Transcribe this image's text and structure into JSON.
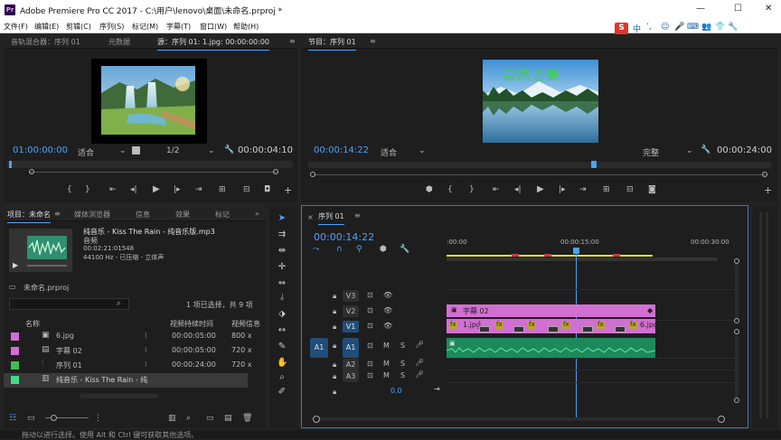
{
  "app": {
    "title": "Adobe Premiere Pro CC 2017 - C:\\用户\\lenovo\\桌面\\未命名.prproj *",
    "logo": "Pr",
    "window_controls": [
      "—",
      "☐",
      "✕"
    ]
  },
  "menu": [
    "文件(F)",
    "编辑(E)",
    "剪辑(C)",
    "序列(S)",
    "标记(M)",
    "字幕(T)",
    "窗口(W)",
    "帮助(H)"
  ],
  "ime": {
    "logo": "S",
    "items": [
      "中",
      "ʼ,",
      "☺",
      "🎤",
      "⌨",
      "👥",
      "👕",
      "🔧"
    ]
  },
  "source_panel": {
    "tabs": [
      "音轨混合器：序列 01",
      "元数据",
      "源：序列 01: 1.jpg: 00:00:00:00"
    ],
    "menu_icon": "≡",
    "timecode": "01:00:00:00",
    "fit": "适合",
    "resolution": "1/2",
    "duration": "00:00:04:10"
  },
  "program_panel": {
    "tab": "节目：序列 01",
    "menu_icon": "≡",
    "overlay_text": "自然之美",
    "timecode": "00:00:14:22",
    "fit": "适合",
    "quality": "完整",
    "duration": "00:00:24:00"
  },
  "project_panel": {
    "tabs": [
      "项目：未命名",
      "媒体浏览器",
      "信息",
      "效果",
      "标记"
    ],
    "more": "»",
    "clip_name": "纯音乐 - Kiss The Rain - 纯音乐版.mp3",
    "clip_type": "音频",
    "clip_duration": "00:02:21:01548",
    "clip_format": "44100 Hz - 已压缩 - 立体声",
    "project_file": "未命名.prproj",
    "selection_info": "1 项已选择，共 9 项",
    "columns": [
      "名称",
      "视频持续时间",
      "视频信息"
    ],
    "items": [
      {
        "name": "6.jpg",
        "duration": "00:00:05:00",
        "info": "800 x",
        "color": "#d46bd4",
        "icon": "image-icon"
      },
      {
        "name": "字幕 02",
        "duration": "00:00:05:00",
        "info": "720 x",
        "color": "#d46bd4",
        "icon": "title-icon"
      },
      {
        "name": "序列 01",
        "duration": "00:00:24:00",
        "info": "720 x",
        "color": "#3fbf4f",
        "icon": "sequence-icon"
      },
      {
        "name": "纯音乐 - Kiss The Rain - 纯",
        "duration": "",
        "info": "",
        "color": "#3fdc8a",
        "icon": "audio-icon"
      }
    ]
  },
  "timeline": {
    "tab": "序列 01",
    "menu_icon": "≡",
    "timecode": "00:00:14:22",
    "ruler": [
      ":00:00",
      "00:00:15:00",
      "00:00:30:00"
    ],
    "video_tracks": [
      {
        "label": "V3",
        "active": false
      },
      {
        "label": "V2",
        "active": false
      },
      {
        "label": "V1",
        "active": true
      }
    ],
    "audio_tracks": [
      {
        "label": "A1",
        "active": true,
        "source": "A1"
      },
      {
        "label": "A2",
        "active": false,
        "source": ""
      },
      {
        "label": "A3",
        "active": false,
        "source": ""
      }
    ],
    "track_buttons": {
      "mute": "M",
      "solo": "S"
    },
    "master_value": "0.0",
    "clips": {
      "title_clip": "字幕 02",
      "v1_first": "1.jpg",
      "v1_last": "6.jpg",
      "fx": "fx"
    }
  },
  "status_bar": "拖动以进行选择。使用 Alt 和 Ctrl 键可获取其他选项。",
  "colors": {
    "accent": "#4aa3ff",
    "video_clip": "#d26fd2",
    "audio_clip": "#1d8a5c",
    "panel_bg": "#1e1e1e"
  }
}
